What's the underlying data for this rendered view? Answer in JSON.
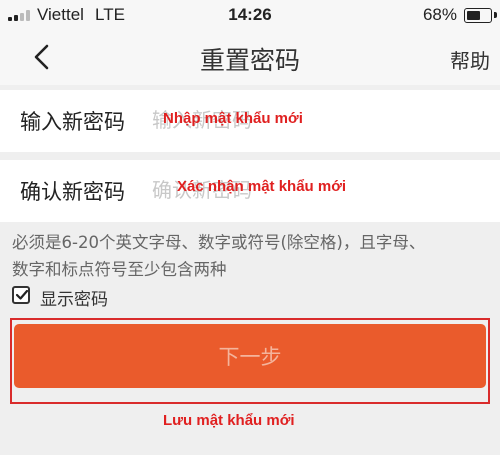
{
  "status_bar": {
    "carrier": "Viettel",
    "network": "LTE",
    "time": "14:26",
    "battery_percent": "68%",
    "battery_level": 0.68,
    "signal_bars_filled": 2
  },
  "nav": {
    "back_icon": "chevron-left-icon",
    "title": "重置密码",
    "help_label": "帮助"
  },
  "form": {
    "new_password": {
      "label": "输入新密码",
      "placeholder": "输入新密码",
      "value": ""
    },
    "confirm_password": {
      "label": "确认新密码",
      "placeholder": "确认新密码",
      "value": ""
    },
    "hint_line1": "必须是6-20个英文字母、数字或符号(除空格)，且字母、",
    "hint_line2": "数字和标点符号至少包含两种",
    "show_password": {
      "label": "显示密码",
      "checked": true
    },
    "next_button_label": "下一步"
  },
  "annotations": {
    "new_password_note": "Nhập mật khẩu mới",
    "confirm_password_note": "Xác nhận mật khẩu mới",
    "save_note": "Lưu mật khẩu mới"
  },
  "colors": {
    "accent": "#ea5b2c",
    "annotation_red": "#e02020",
    "button_text": "#f4b49c"
  }
}
